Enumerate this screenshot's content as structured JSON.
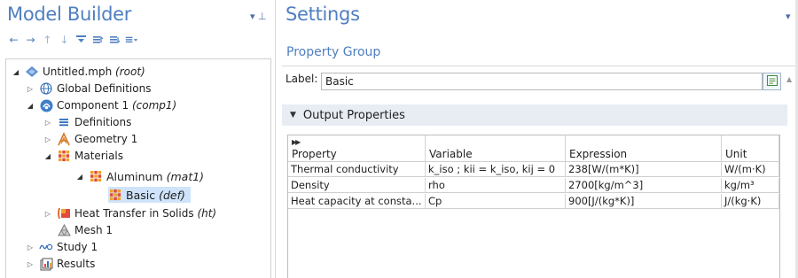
{
  "model_builder": {
    "title": "Model Builder",
    "toolbar": [
      {
        "icon": "arrow-left-icon",
        "glyph": "←"
      },
      {
        "icon": "arrow-right-icon",
        "glyph": "→"
      },
      {
        "icon": "arrow-up-icon",
        "glyph": "↑"
      },
      {
        "icon": "arrow-down-icon",
        "glyph": "↓"
      },
      {
        "icon": "show-icon",
        "glyph": "≡"
      },
      {
        "icon": "collapse-icon",
        "glyph": "≣"
      },
      {
        "icon": "expand-icon",
        "glyph": "≣"
      },
      {
        "icon": "list-menu-icon",
        "glyph": "≡"
      }
    ],
    "tree": [
      {
        "label": "Untitled.mph",
        "suffix": "(root)",
        "icon": "model-icon"
      },
      {
        "label": "Global Definitions",
        "suffix": "",
        "icon": "globe-icon"
      },
      {
        "label": "Component 1",
        "suffix": "(comp1)",
        "icon": "component-icon"
      },
      {
        "label": "Definitions",
        "suffix": "",
        "icon": "definitions-icon"
      },
      {
        "label": "Geometry 1",
        "suffix": "",
        "icon": "geometry-icon"
      },
      {
        "label": "Materials",
        "suffix": "",
        "icon": "materials-icon"
      },
      {
        "label": "Aluminum",
        "suffix": "(mat1)",
        "icon": "material-icon"
      },
      {
        "label": "Basic",
        "suffix": "(def)",
        "icon": "property-group-icon"
      },
      {
        "label": "Heat Transfer in Solids",
        "suffix": "(ht)",
        "icon": "heat-transfer-icon"
      },
      {
        "label": "Mesh 1",
        "suffix": "",
        "icon": "mesh-icon"
      },
      {
        "label": "Study 1",
        "suffix": "",
        "icon": "study-icon"
      },
      {
        "label": "Results",
        "suffix": "",
        "icon": "results-icon"
      }
    ]
  },
  "settings": {
    "title": "Settings",
    "subtitle": "Property Group",
    "label_caption": "Label:",
    "label_value": "Basic",
    "section_title": "Output Properties",
    "table": {
      "headers": [
        "Property",
        "Variable",
        "Expression",
        "Unit"
      ],
      "rows": [
        [
          "Thermal conductivity",
          "k_iso ; kii = k_iso, kij = 0",
          "238[W/(m*K)]",
          "W/(m·K)"
        ],
        [
          "Density",
          "rho",
          "2700[kg/m^3]",
          "kg/m³"
        ],
        [
          "Heat capacity at consta...",
          "Cp",
          "900[J/(kg*K)]",
          "J/(kg·K)"
        ]
      ]
    }
  },
  "colors": {
    "title_blue": "#4f7fc0",
    "selection": "#cfe3fa",
    "section_bg": "#e8edf4"
  }
}
